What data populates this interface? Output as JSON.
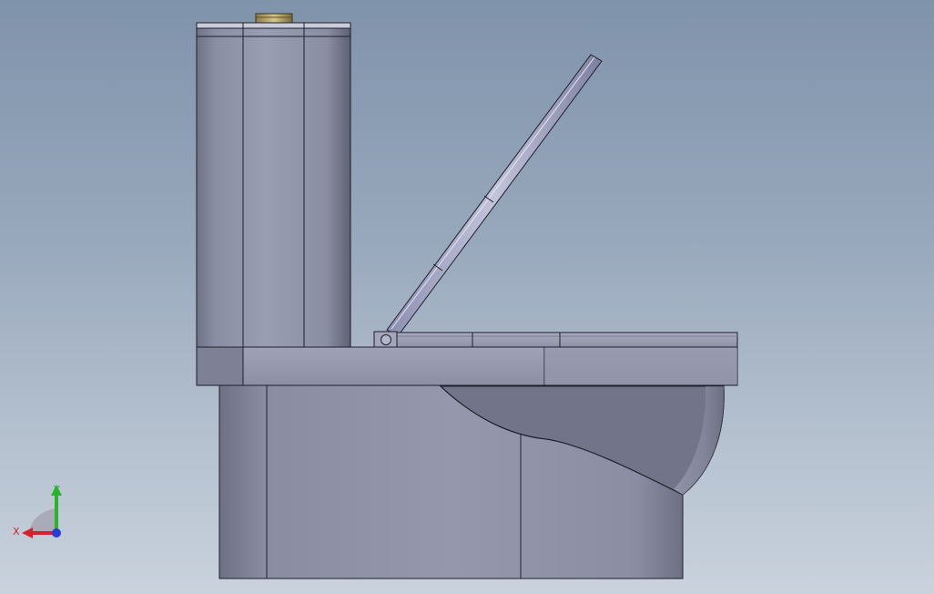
{
  "viewport": {
    "background_top": "#7f93ab",
    "background_bottom": "#c9d2dd"
  },
  "model": {
    "name": "toilet-model",
    "parts": [
      "tank",
      "flush-button",
      "tank-base",
      "seat-lid",
      "hinge",
      "seat",
      "bowl",
      "pedestal"
    ]
  },
  "triad": {
    "x_label": "X",
    "y_label": "Y",
    "x_color": "#d0232a",
    "y_color": "#29b42a",
    "z_color": "#2a3bd0"
  }
}
